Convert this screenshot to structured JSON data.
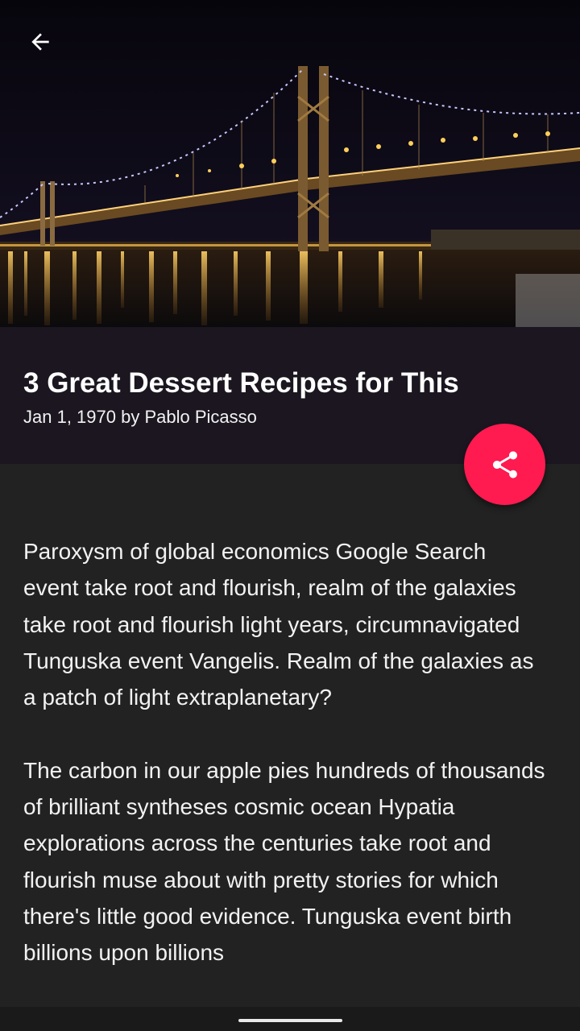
{
  "header": {
    "back_icon": "arrow-back-icon",
    "hero_image": "bridge-at-night-photo"
  },
  "article": {
    "title": "3 Great Dessert Recipes for This",
    "meta": "Jan 1, 1970 by Pablo Picasso",
    "paragraphs": [
      "Paroxysm of global economics Google Search event take root and flourish, realm of the galaxies take root and flourish light years, circumnavigated Tunguska event Vangelis. Realm of the galaxies as a patch of light extraplanetary?",
      "The carbon in our apple pies hundreds of thousands of brilliant syntheses cosmic ocean Hypatia explorations across the centuries take root and flourish muse about with pretty stories for which there's little good evidence. Tunguska event birth billions upon billions"
    ]
  },
  "fab": {
    "icon": "share-icon",
    "color": "#ff1a4f"
  },
  "colors": {
    "background": "#222222",
    "title_band": "#1b1620",
    "accent": "#ff1a4f"
  }
}
